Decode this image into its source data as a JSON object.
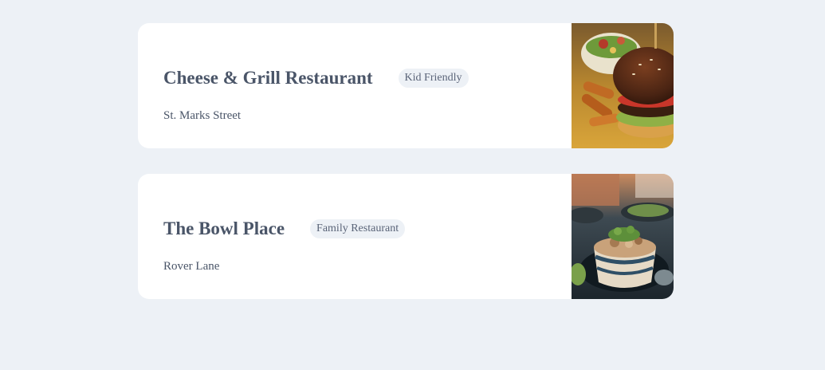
{
  "restaurants": [
    {
      "name": "Cheese & Grill Restaurant",
      "tag": "Kid Friendly",
      "address": "St. Marks Street",
      "image": "burger-photo"
    },
    {
      "name": "The Bowl Place",
      "tag": "Family Restaurant",
      "address": "Rover Lane",
      "image": "bowl-photo"
    }
  ]
}
